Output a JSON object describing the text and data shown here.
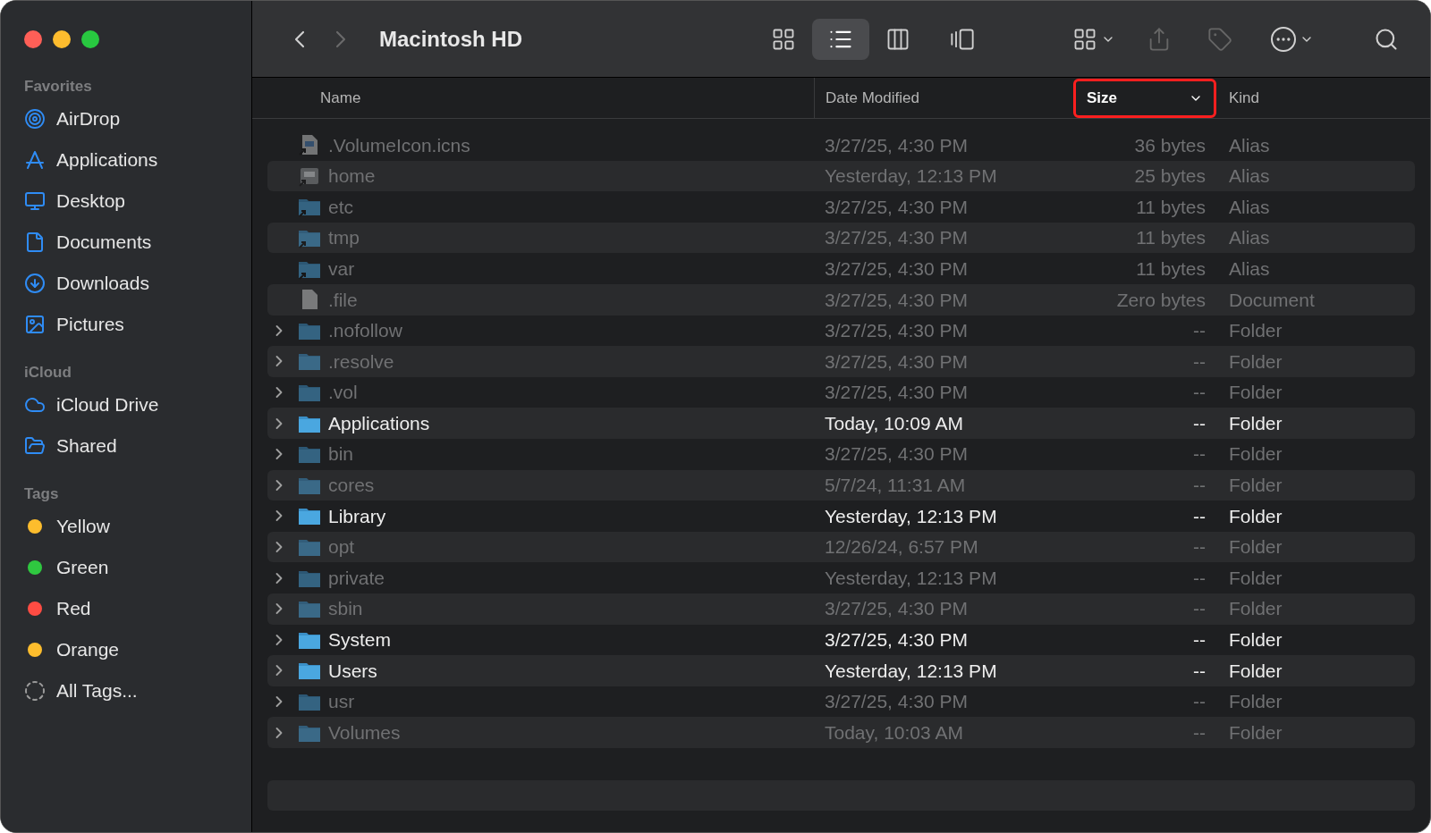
{
  "window": {
    "title": "Macintosh HD"
  },
  "navigation": [
    {
      "kind": "back",
      "disabled": false
    },
    {
      "kind": "forward",
      "disabled": true
    }
  ],
  "views": [
    {
      "kind": "icons",
      "selected": false
    },
    {
      "kind": "list",
      "selected": true
    },
    {
      "kind": "columns",
      "selected": false
    },
    {
      "kind": "gallery",
      "selected": false
    }
  ],
  "actions": [
    {
      "kind": "group",
      "disabled": false
    },
    {
      "kind": "share",
      "disabled": true
    },
    {
      "kind": "tag",
      "disabled": true
    },
    {
      "kind": "more",
      "disabled": false
    },
    {
      "kind": "search",
      "disabled": false
    }
  ],
  "sidebar": {
    "sections": [
      {
        "title": "Favorites",
        "items": [
          {
            "label": "AirDrop",
            "kind": "airdrop"
          },
          {
            "label": "Applications",
            "kind": "applications"
          },
          {
            "label": "Desktop",
            "kind": "desktop"
          },
          {
            "label": "Documents",
            "kind": "documents"
          },
          {
            "label": "Downloads",
            "kind": "downloads"
          },
          {
            "label": "Pictures",
            "kind": "pictures"
          }
        ]
      },
      {
        "title": "iCloud",
        "items": [
          {
            "label": "iCloud Drive",
            "kind": "cloud"
          },
          {
            "label": "Shared",
            "kind": "shared"
          }
        ]
      },
      {
        "title": "Tags",
        "items": [
          {
            "label": "Yellow",
            "kind": "tag",
            "color": "#fdbd2d"
          },
          {
            "label": "Green",
            "kind": "tag",
            "color": "#2fc840"
          },
          {
            "label": "Red",
            "kind": "tag",
            "color": "#fe4c43"
          },
          {
            "label": "Orange",
            "kind": "tag",
            "color": "#fdbd2d"
          },
          {
            "label": "All Tags...",
            "kind": "all-tags"
          }
        ]
      }
    ]
  },
  "table": {
    "columns": [
      {
        "label": "Name",
        "sorted": false,
        "annotated": false
      },
      {
        "label": "Date Modified",
        "sorted": false,
        "annotated": false
      },
      {
        "label": "Size",
        "sorted": true,
        "annotated": true
      },
      {
        "label": "Kind",
        "sorted": false,
        "annotated": false
      }
    ],
    "rows": [
      {
        "name": ".VolumeIcon.icns",
        "date": "3/27/25, 4:30 PM",
        "size": "36 bytes",
        "kind_label": "Alias",
        "kind": "image",
        "alias": true,
        "hidden": true,
        "expandable": false
      },
      {
        "name": "home",
        "date": "Yesterday, 12:13 PM",
        "size": "25 bytes",
        "kind_label": "Alias",
        "kind": "disk",
        "alias": true,
        "hidden": true,
        "expandable": false
      },
      {
        "name": "etc",
        "date": "3/27/25, 4:30 PM",
        "size": "11 bytes",
        "kind_label": "Alias",
        "kind": "folder",
        "alias": true,
        "hidden": true,
        "expandable": false
      },
      {
        "name": "tmp",
        "date": "3/27/25, 4:30 PM",
        "size": "11 bytes",
        "kind_label": "Alias",
        "kind": "folder",
        "alias": true,
        "hidden": true,
        "expandable": false
      },
      {
        "name": "var",
        "date": "3/27/25, 4:30 PM",
        "size": "11 bytes",
        "kind_label": "Alias",
        "kind": "folder",
        "alias": true,
        "hidden": true,
        "expandable": false
      },
      {
        "name": ".file",
        "date": "3/27/25, 4:30 PM",
        "size": "Zero bytes",
        "kind_label": "Document",
        "kind": "document",
        "alias": false,
        "hidden": true,
        "expandable": false
      },
      {
        "name": ".nofollow",
        "date": "3/27/25, 4:30 PM",
        "size": "--",
        "kind_label": "Folder",
        "kind": "folder",
        "alias": false,
        "hidden": true,
        "expandable": true
      },
      {
        "name": ".resolve",
        "date": "3/27/25, 4:30 PM",
        "size": "--",
        "kind_label": "Folder",
        "kind": "folder",
        "alias": false,
        "hidden": true,
        "expandable": true
      },
      {
        "name": ".vol",
        "date": "3/27/25, 4:30 PM",
        "size": "--",
        "kind_label": "Folder",
        "kind": "folder",
        "alias": false,
        "hidden": true,
        "expandable": true
      },
      {
        "name": "Applications",
        "date": "Today, 10:09 AM",
        "size": "--",
        "kind_label": "Folder",
        "kind": "folder",
        "alias": false,
        "hidden": false,
        "expandable": true
      },
      {
        "name": "bin",
        "date": "3/27/25, 4:30 PM",
        "size": "--",
        "kind_label": "Folder",
        "kind": "folder",
        "alias": false,
        "hidden": true,
        "expandable": true
      },
      {
        "name": "cores",
        "date": "5/7/24, 11:31 AM",
        "size": "--",
        "kind_label": "Folder",
        "kind": "folder",
        "alias": false,
        "hidden": true,
        "expandable": true
      },
      {
        "name": "Library",
        "date": "Yesterday, 12:13 PM",
        "size": "--",
        "kind_label": "Folder",
        "kind": "folder",
        "alias": false,
        "hidden": false,
        "expandable": true
      },
      {
        "name": "opt",
        "date": "12/26/24, 6:57 PM",
        "size": "--",
        "kind_label": "Folder",
        "kind": "folder",
        "alias": false,
        "hidden": true,
        "expandable": true
      },
      {
        "name": "private",
        "date": "Yesterday, 12:13 PM",
        "size": "--",
        "kind_label": "Folder",
        "kind": "folder",
        "alias": false,
        "hidden": true,
        "expandable": true
      },
      {
        "name": "sbin",
        "date": "3/27/25, 4:30 PM",
        "size": "--",
        "kind_label": "Folder",
        "kind": "folder",
        "alias": false,
        "hidden": true,
        "expandable": true
      },
      {
        "name": "System",
        "date": "3/27/25, 4:30 PM",
        "size": "--",
        "kind_label": "Folder",
        "kind": "folder",
        "alias": false,
        "hidden": false,
        "expandable": true
      },
      {
        "name": "Users",
        "date": "Yesterday, 12:13 PM",
        "size": "--",
        "kind_label": "Folder",
        "kind": "folder",
        "alias": false,
        "hidden": false,
        "expandable": true
      },
      {
        "name": "usr",
        "date": "3/27/25, 4:30 PM",
        "size": "--",
        "kind_label": "Folder",
        "kind": "folder",
        "alias": false,
        "hidden": true,
        "expandable": true
      },
      {
        "name": "Volumes",
        "date": "Today, 10:03 AM",
        "size": "--",
        "kind_label": "Folder",
        "kind": "folder",
        "alias": false,
        "hidden": true,
        "expandable": true
      }
    ]
  }
}
